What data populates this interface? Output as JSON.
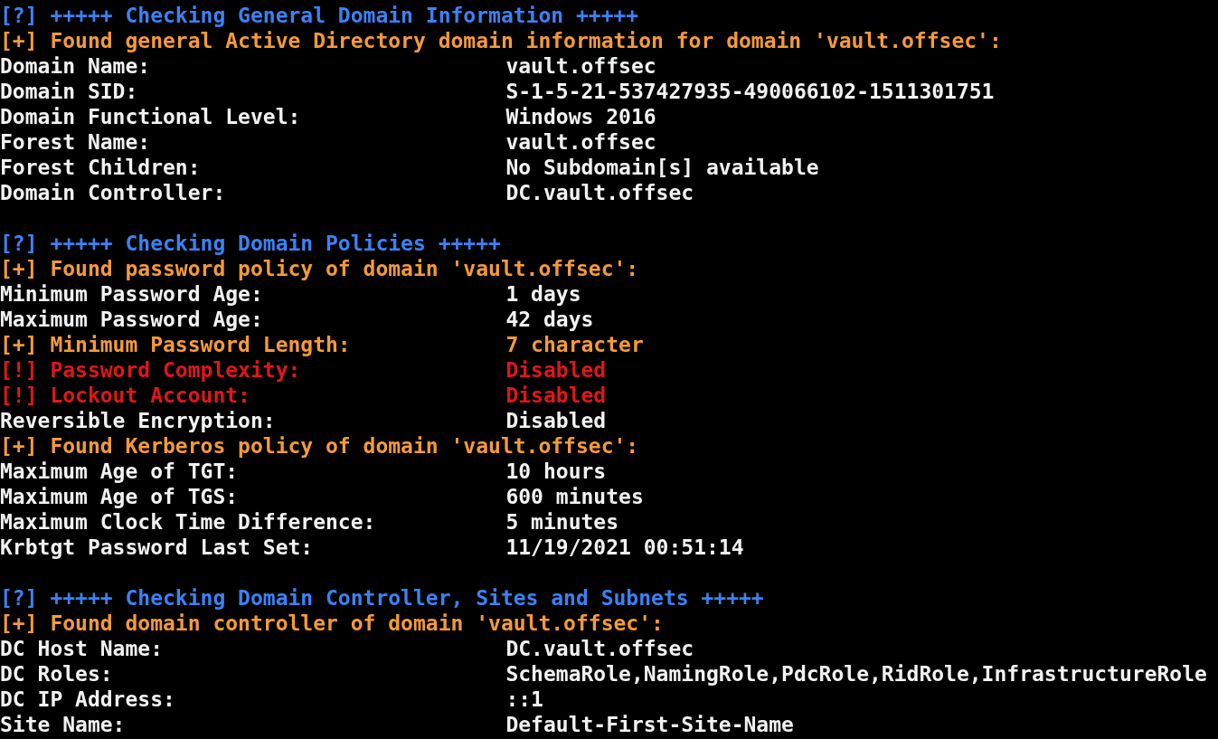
{
  "lines": [
    {
      "kind": "heading",
      "text": "[?] +++++ Checking General Domain Information +++++"
    },
    {
      "kind": "found",
      "text": "[+] Found general Active Directory domain information for domain 'vault.offsec':"
    },
    {
      "kind": "info",
      "label": "Domain Name:",
      "value": "vault.offsec"
    },
    {
      "kind": "info",
      "label": "Domain SID:",
      "value": "S-1-5-21-537427935-490066102-1511301751"
    },
    {
      "kind": "info",
      "label": "Domain Functional Level:",
      "value": "Windows 2016"
    },
    {
      "kind": "info",
      "label": "Forest Name:",
      "value": "vault.offsec"
    },
    {
      "kind": "info",
      "label": "Forest Children:",
      "value": "No Subdomain[s] available"
    },
    {
      "kind": "info",
      "label": "Domain Controller:",
      "value": "DC.vault.offsec"
    },
    {
      "kind": "blank"
    },
    {
      "kind": "heading",
      "text": "[?] +++++ Checking Domain Policies +++++"
    },
    {
      "kind": "found",
      "text": "[+] Found password policy of domain 'vault.offsec':"
    },
    {
      "kind": "info",
      "label": "Minimum Password Age:",
      "value": "1 days"
    },
    {
      "kind": "info",
      "label": "Maximum Password Age:",
      "value": "42 days"
    },
    {
      "kind": "notice",
      "label": "[+] Minimum Password Length:",
      "value": "7 character"
    },
    {
      "kind": "alert",
      "label": "[!] Password Complexity:",
      "value": "Disabled"
    },
    {
      "kind": "alert",
      "label": "[!] Lockout Account:",
      "value": "Disabled"
    },
    {
      "kind": "info",
      "label": "Reversible Encryption:",
      "value": "Disabled"
    },
    {
      "kind": "found",
      "text": "[+] Found Kerberos policy of domain 'vault.offsec':"
    },
    {
      "kind": "info",
      "label": "Maximum Age of TGT:",
      "value": "10 hours"
    },
    {
      "kind": "info",
      "label": "Maximum Age of TGS:",
      "value": "600 minutes"
    },
    {
      "kind": "info",
      "label": "Maximum Clock Time Difference:",
      "value": "5 minutes"
    },
    {
      "kind": "info",
      "label": "Krbtgt Password Last Set:",
      "value": "11/19/2021 00:51:14"
    },
    {
      "kind": "blank"
    },
    {
      "kind": "heading",
      "text": "[?] +++++ Checking Domain Controller, Sites and Subnets +++++"
    },
    {
      "kind": "found",
      "text": "[+] Found domain controller of domain 'vault.offsec':"
    },
    {
      "kind": "info",
      "label": "DC Host Name:",
      "value": "DC.vault.offsec"
    },
    {
      "kind": "info",
      "label": "DC Roles:",
      "value": "SchemaRole,NamingRole,PdcRole,RidRole,InfrastructureRole"
    },
    {
      "kind": "info",
      "label": "DC IP Address:",
      "value": "::1"
    },
    {
      "kind": "info",
      "label": "Site Name:",
      "value": "Default-First-Site-Name"
    }
  ]
}
